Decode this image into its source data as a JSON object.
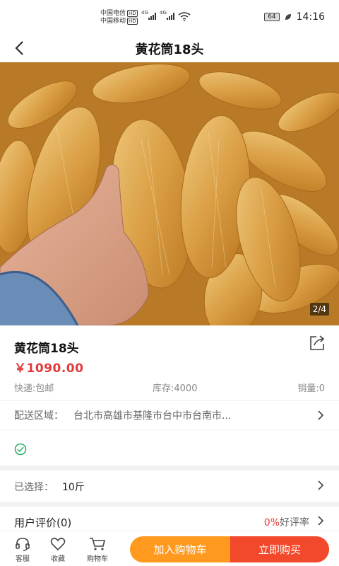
{
  "status_bar": {
    "carrier_1": "中国电信",
    "carrier_2": "中国移动",
    "hd": "HD",
    "network_1": "4G",
    "network_2": "4G",
    "battery": "64",
    "time": "14:16"
  },
  "nav": {
    "title": "黄花筒18头",
    "back_icon": "chevron-left-icon"
  },
  "gallery": {
    "counter": "2/4"
  },
  "product": {
    "name": "黄花筒18头",
    "price": "￥1090.00",
    "shipping": "快递:包邮",
    "stock": "库存:4000",
    "sales": "销量:0",
    "share_icon": "share-icon"
  },
  "delivery": {
    "label": "配送区域：",
    "value": "台北市高雄市基隆市台中市台南市..."
  },
  "guarantee": {
    "icon": "check-circle-icon"
  },
  "selected": {
    "label": "已选择：",
    "value": "10斤"
  },
  "reviews": {
    "label": "用户评价(0)",
    "rate_value": "0%",
    "rate_label": "好评率"
  },
  "bottom_bar": {
    "service_label": "客服",
    "favorite_label": "收藏",
    "cart_label": "购物车",
    "add_to_cart": "加入购物车",
    "buy_now": "立即购买"
  },
  "colors": {
    "accent_red": "#e4393c",
    "cart_orange": "#ff9a1f",
    "buy_red": "#f2482b",
    "check_green": "#27ae60"
  }
}
